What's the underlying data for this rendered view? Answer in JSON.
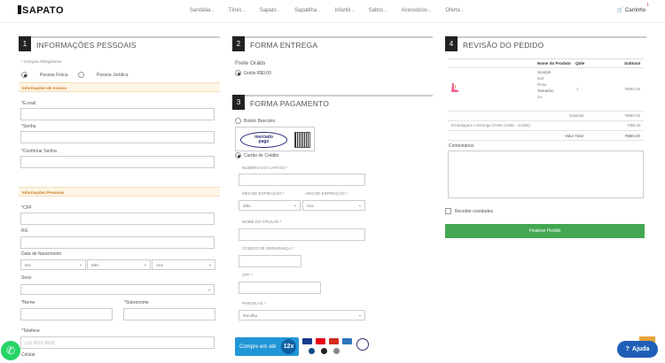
{
  "brand": {
    "logo_text": "SAPATO"
  },
  "nav": {
    "items": [
      "Sandália",
      "Tênis",
      "Sapato",
      "Sapatilha",
      "Infantil",
      "Saltos",
      "Acessórios",
      "Oferta"
    ],
    "cart_label": "Carrinho",
    "cart_count": "1"
  },
  "personal": {
    "number": "1",
    "title": "INFORMAÇÕES PESSOAIS",
    "required_note": "* Campos Obrigatórios",
    "person_types": [
      "Pessoa Física",
      "Pessoa Jurídica"
    ],
    "selected_person_type": "Pessoa Física",
    "access_band": "Informações de Acesso",
    "email_label": "*E-mail",
    "password_label": "*Senha",
    "confirm_password_label": "*Confirmar Senha",
    "personal_band": "Informações Pessoais",
    "cpf_label": "*CPF",
    "rg_label": "RG",
    "birth_label": "Data de Nascimento",
    "birth_day": "Dia",
    "birth_month": "Mês",
    "birth_year": "Ano",
    "sex_label": "Sexo",
    "first_name_label": "*Nome",
    "last_name_label": "*Sobrenome",
    "phone_label": "*Telefone",
    "phone_placeholder": "(xx) 4567-8900",
    "mobile_label": "Celular"
  },
  "delivery": {
    "number": "2",
    "title": "FORMA ENTREGA",
    "free_shipping": "Frete Grátis",
    "option": "Grátis R$0,00"
  },
  "payment": {
    "number": "3",
    "title": "FORMA PAGAMENTO",
    "boleto_label": "Boleto Bancário",
    "mercado_line1": "mercado",
    "mercado_line2": "pago",
    "credit_label": "Cartão de Crédito",
    "card_number_label": "NÚMERO DO CARTÃO *",
    "exp_month_label": "MÊS DE EXPIRAÇÃO *",
    "exp_year_label": "ANO DE EXPIRAÇÃO *",
    "exp_month_value": "Mês",
    "exp_year_value": "Ano",
    "holder_label": "NOME DO TITULAR *",
    "cvv_label": "CÓDIGO DE SEGURANÇA *",
    "cpf_label": "CPF *",
    "installments_label": "PARCELAS *",
    "installments_value": "Escolha",
    "banner_text": "Compre em até",
    "banner_badge": "12x"
  },
  "review": {
    "number": "4",
    "title": "REVISÃO DO PEDIDO",
    "headers": [
      "Nome do Produto",
      "Qtde",
      "Subtotal"
    ],
    "product": {
      "name_lines": [
        "Scarpin",
        "Cor"
      ],
      "meta_lines": [
        "Rosa",
        "Tamanho",
        "34"
      ],
      "qty": "1",
      "subtotal": "R$60,00"
    },
    "subtotal_label": "Subtotal",
    "subtotal_value": "R$60,00",
    "shipping_label": "Embalagem e Entrega (Frete Grátis - Grátis)",
    "shipping_value": "R$0,00",
    "total_label": "Valor Total",
    "total_value": "R$60,00",
    "comments_label": "Comentários",
    "newsletter_label": "Receber novidades",
    "finalize_label": "Finalizar Pedido"
  },
  "help_label": "Ajuda",
  "colors": {
    "accent_green": "#43a851",
    "help_blue": "#1f5fb8",
    "banner_blue": "#2196d6",
    "band_orange": "#d07a1c"
  }
}
